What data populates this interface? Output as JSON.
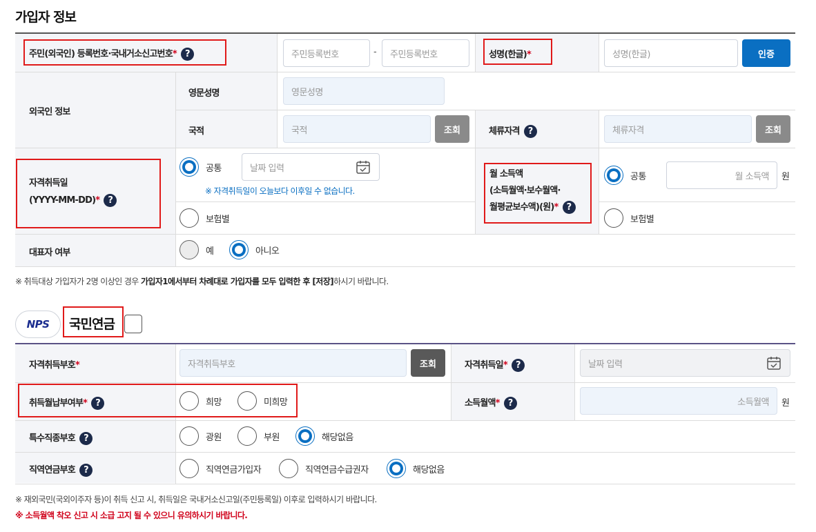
{
  "section1": {
    "title": "가입자 정보",
    "rrn": {
      "label": "주민(외국인) 등록번호·국내거소신고번호",
      "req": "*",
      "input1_placeholder": "주민등록번호",
      "separator": "-",
      "input2_placeholder": "주민등록번호"
    },
    "name": {
      "label": "성명(한글)",
      "req": "*",
      "placeholder": "성명(한글)",
      "button": "인증"
    },
    "foreigner": {
      "label": "외국인 정보",
      "eng_name_label": "영문성명",
      "eng_name_placeholder": "영문성명",
      "nation_label": "국적",
      "nation_placeholder": "국적",
      "nation_button": "조회",
      "stay_label": "체류자격",
      "stay_placeholder": "체류자격",
      "stay_button": "조회"
    },
    "acq_date": {
      "label_line1": "자격취득일",
      "label_line2": "(YYYY-MM-DD)",
      "req": "*",
      "opt_common": "공통",
      "date_placeholder": "날짜 입력",
      "note": "※ 자격취득일이 오늘보다 이후일 수 없습니다.",
      "opt_by_insurance": "보험별"
    },
    "monthly_income": {
      "label_line1": "월 소득액",
      "label_line2": "(소득월액·보수월액·",
      "label_line3": "월평균보수액)(원)",
      "req": "*",
      "opt_common": "공통",
      "placeholder": "월 소득액",
      "unit": "원",
      "opt_by_insurance": "보험별"
    },
    "representative": {
      "label": "대표자 여부",
      "opt_yes": "예",
      "opt_no": "아니오"
    },
    "footnote_prefix": "※ 취득대상 가입자가 2명 이상인 경우 ",
    "footnote_bold": "가입자1에서부터 차례대로 가입자를 모두 입력한 후 [저장]",
    "footnote_suffix": "하시기 바랍니다."
  },
  "section2": {
    "logo_text": "NPS",
    "title": "국민연금",
    "acq_code": {
      "label": "자격취득부호",
      "req": "*",
      "placeholder": "자격취득부호",
      "button": "조회"
    },
    "acq_date": {
      "label": "자격취득일",
      "req": "*",
      "placeholder": "날짜 입력"
    },
    "monthly_payment": {
      "label": "취득월납부여부",
      "req": "*",
      "opt_hope": "희망",
      "opt_nohope": "미희망"
    },
    "income": {
      "label": "소득월액",
      "req": "*",
      "placeholder": "소득월액",
      "unit": "원"
    },
    "special_job": {
      "label": "특수직종부호",
      "opt1": "광원",
      "opt2": "부원",
      "opt3": "해당없음"
    },
    "occupational": {
      "label": "직역연금부호",
      "opt1": "직역연금가입자",
      "opt2": "직역연금수급권자",
      "opt3": "해당없음"
    },
    "note1": "※ 재외국민(국외이주자 등)이 취득 신고 시, 취득일은 국내거소신고일(주민등록일) 이후로 입력하시기 바랍니다.",
    "note2": "※ 소득월액 착오 신고 시 소급 고지 될 수 있으니 유의하시기 바랍니다."
  },
  "colors": {
    "accent_blue": "#0a6fc2",
    "required_red": "#d0021b",
    "highlight_box": "#e01919",
    "help_icon_bg": "#1c2a4a"
  }
}
